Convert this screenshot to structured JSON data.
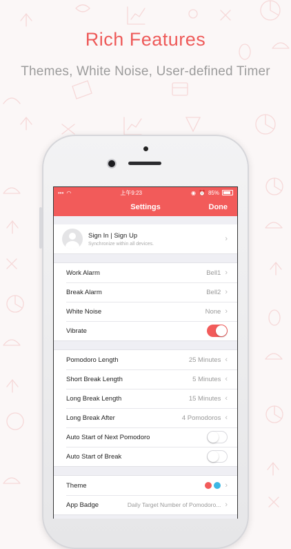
{
  "headline": "Rich Features",
  "subline": "Themes, White Noise, User-defined Timer",
  "status": {
    "time": "上午9:23",
    "battery": "85%"
  },
  "nav": {
    "title": "Settings",
    "done": "Done"
  },
  "account": {
    "title": "Sign In | Sign Up",
    "subtitle": "Synchronize within all devices."
  },
  "sounds": [
    {
      "label": "Work Alarm",
      "value": "Bell1"
    },
    {
      "label": "Break Alarm",
      "value": "Bell2"
    },
    {
      "label": "White Noise",
      "value": "None"
    }
  ],
  "vibrate": {
    "label": "Vibrate",
    "on": true
  },
  "timers": [
    {
      "label": "Pomodoro Length",
      "value": "25 Minutes"
    },
    {
      "label": "Short Break Length",
      "value": "5 Minutes"
    },
    {
      "label": "Long Break Length",
      "value": "15 Minutes"
    },
    {
      "label": "Long Break After",
      "value": "4 Pomodoros"
    }
  ],
  "auto_next": {
    "label": "Auto Start of Next Pomodoro",
    "on": false
  },
  "auto_break": {
    "label": "Auto Start of Break",
    "on": false
  },
  "theme": {
    "label": "Theme",
    "colors": [
      "#f25b5a",
      "#3cb7e4"
    ]
  },
  "badge": {
    "label": "App Badge",
    "value": "Daily Target Number of Pomodoro..."
  },
  "colors": {
    "accent": "#f25b5a",
    "headline": "#ee5a59"
  }
}
